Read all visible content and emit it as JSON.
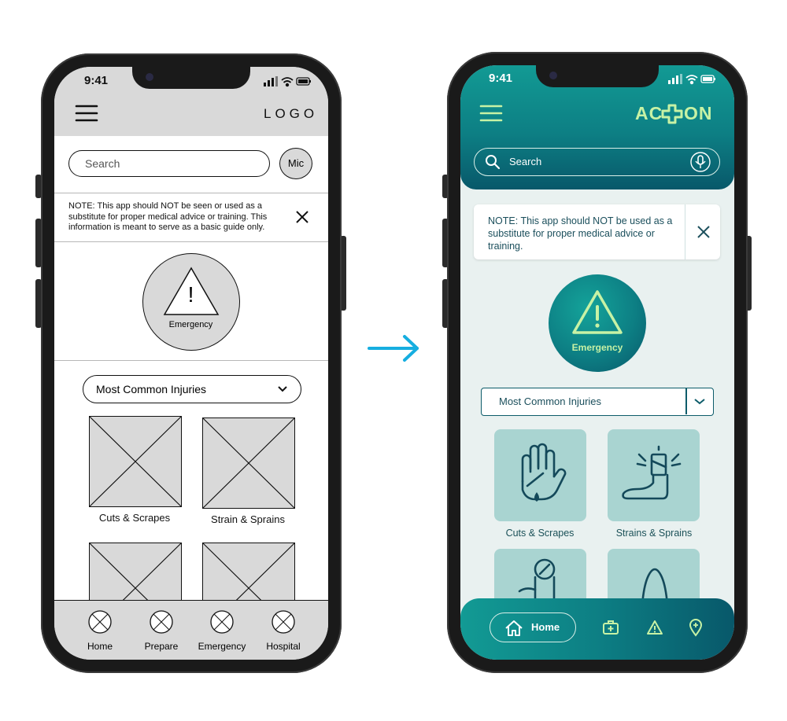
{
  "wireframe": {
    "status_time": "9:41",
    "logo": "LOGO",
    "search_placeholder": "Search",
    "mic_label": "Mic",
    "note": "NOTE: This app should NOT be seen or used as a substitute for proper medical advice or training. This information is meant to serve as a basic guide only.",
    "emergency_label": "Emergency",
    "emergency_symbol": "!",
    "dropdown_label": "Most Common Injuries",
    "tiles": [
      "Cuts & Scrapes",
      "Strain & Sprains"
    ],
    "nav": [
      "Home",
      "Prepare",
      "Emergency",
      "Hospital"
    ]
  },
  "final": {
    "status_time": "9:41",
    "logo_left": "AC",
    "logo_right": "ON",
    "search_placeholder": "Search",
    "note": "NOTE: This app should NOT be used as a substitute for proper medical advice or training.",
    "emergency_label": "Emergency",
    "dropdown_label": "Most Common Injuries",
    "tiles": [
      "Cuts & Scrapes",
      "Strains & Sprains"
    ],
    "nav_home": "Home",
    "colors": {
      "teal_dark": "#08586a",
      "teal": "#129a94",
      "accent_lime": "#c7f2a5",
      "tile_bg": "#a9d4d1",
      "screen_bg": "#e9f1f0"
    }
  },
  "icons": {
    "wireframe": [
      "hamburger-icon",
      "close-icon",
      "warning-icon",
      "chevron-down-icon",
      "placeholder-image-icon",
      "nav-circle-icon",
      "signal-icon",
      "wifi-icon",
      "battery-icon"
    ],
    "final": [
      "hamburger-icon",
      "search-icon",
      "mic-icon",
      "close-icon",
      "warning-icon",
      "chevron-down-icon",
      "hand-cut-icon",
      "sprained-foot-icon",
      "home-icon",
      "first-aid-kit-icon",
      "alert-icon",
      "location-pin-icon"
    ]
  },
  "transition": "arrow-right-icon"
}
